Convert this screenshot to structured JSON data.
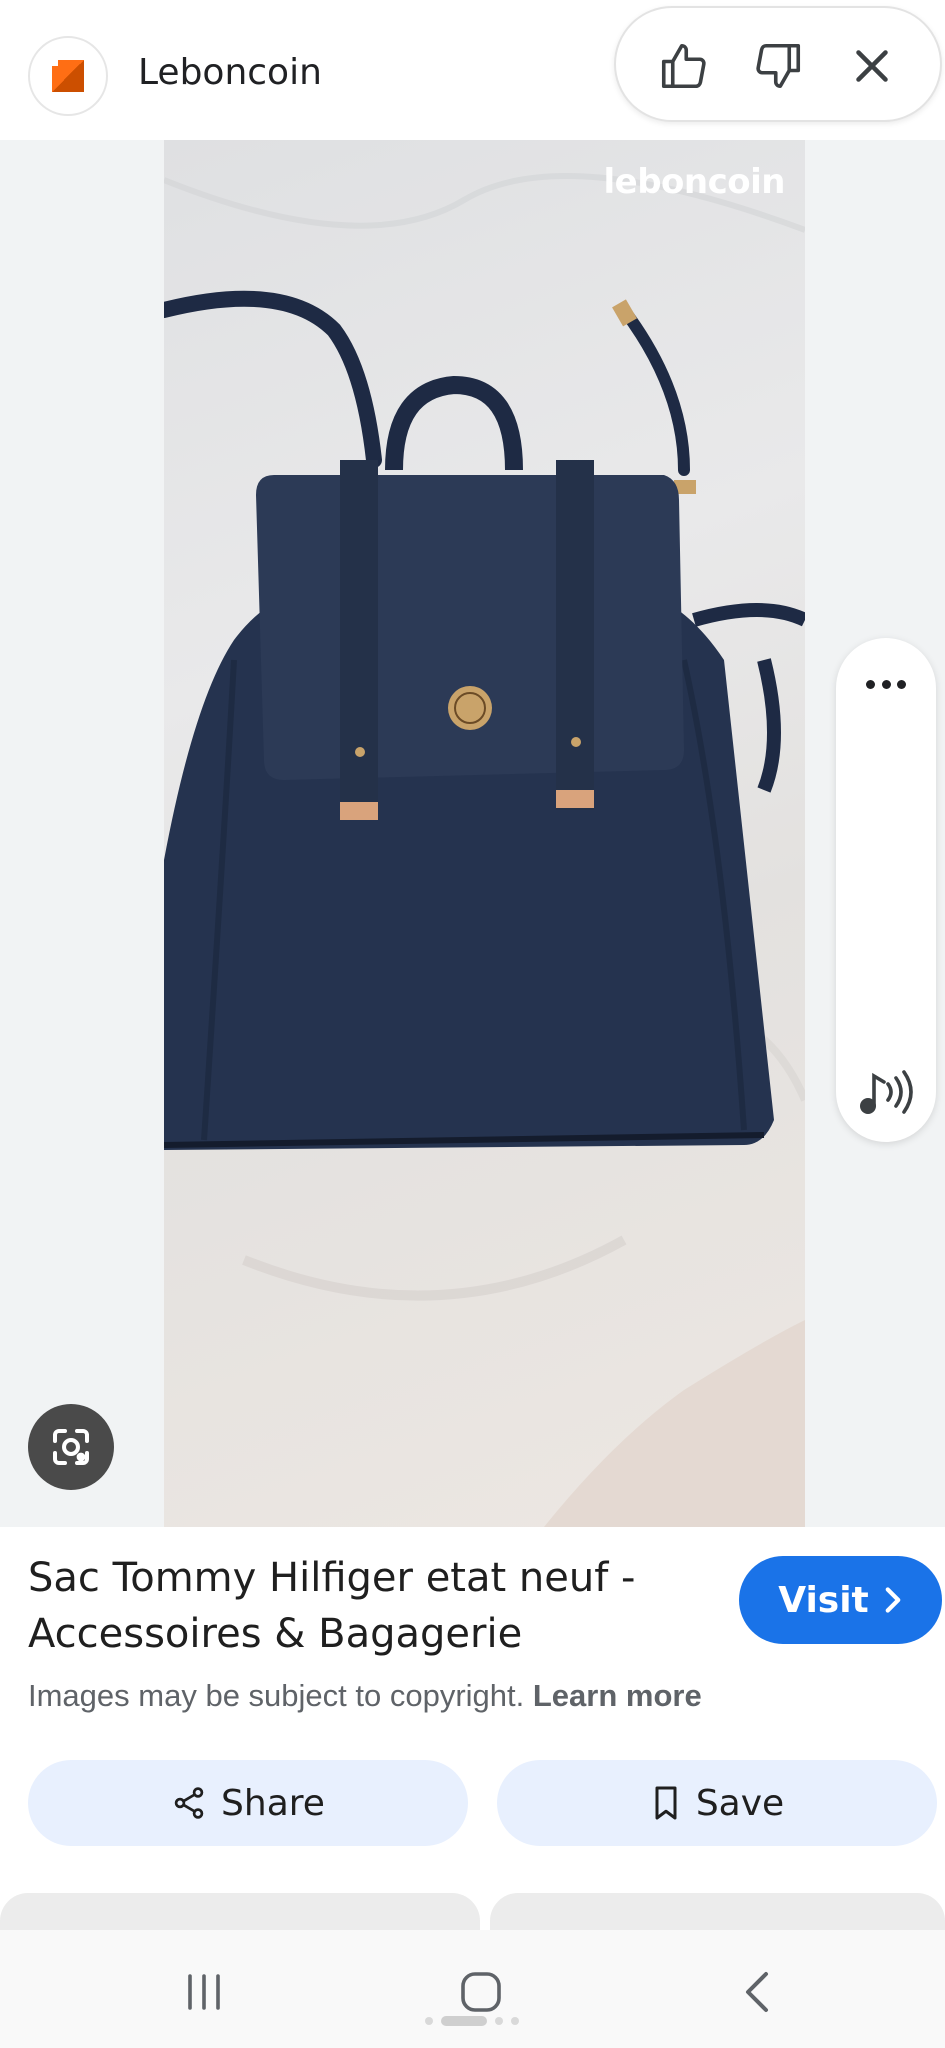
{
  "header": {
    "site_name": "Leboncoin",
    "favicon": "leboncoin-logo",
    "feedback": {
      "like_icon": "thumbs-up-icon",
      "dislike_icon": "thumbs-down-icon",
      "close_icon": "close-icon"
    }
  },
  "image": {
    "watermark": "leboncoin",
    "subject": "navy blue backpack",
    "side_panel": {
      "more_icon": "more-horizontal-icon",
      "audio_icon": "audio-icon"
    },
    "lens_icon": "google-lens-icon"
  },
  "result": {
    "title": "Sac Tommy Hilfiger etat neuf - Accessoires & Bagagerie",
    "visit_label": "Visit",
    "copyright_text": "Images may be subject to copyright.",
    "learn_more": "Learn more",
    "share_label": "Share",
    "save_label": "Save"
  },
  "navbar": {
    "recent_icon": "recent-apps-icon",
    "home_icon": "home-icon",
    "back_icon": "back-icon"
  },
  "colors": {
    "accent": "#1a73e8",
    "action_bg": "#e8f0fe",
    "brand": "#ff6e14"
  }
}
